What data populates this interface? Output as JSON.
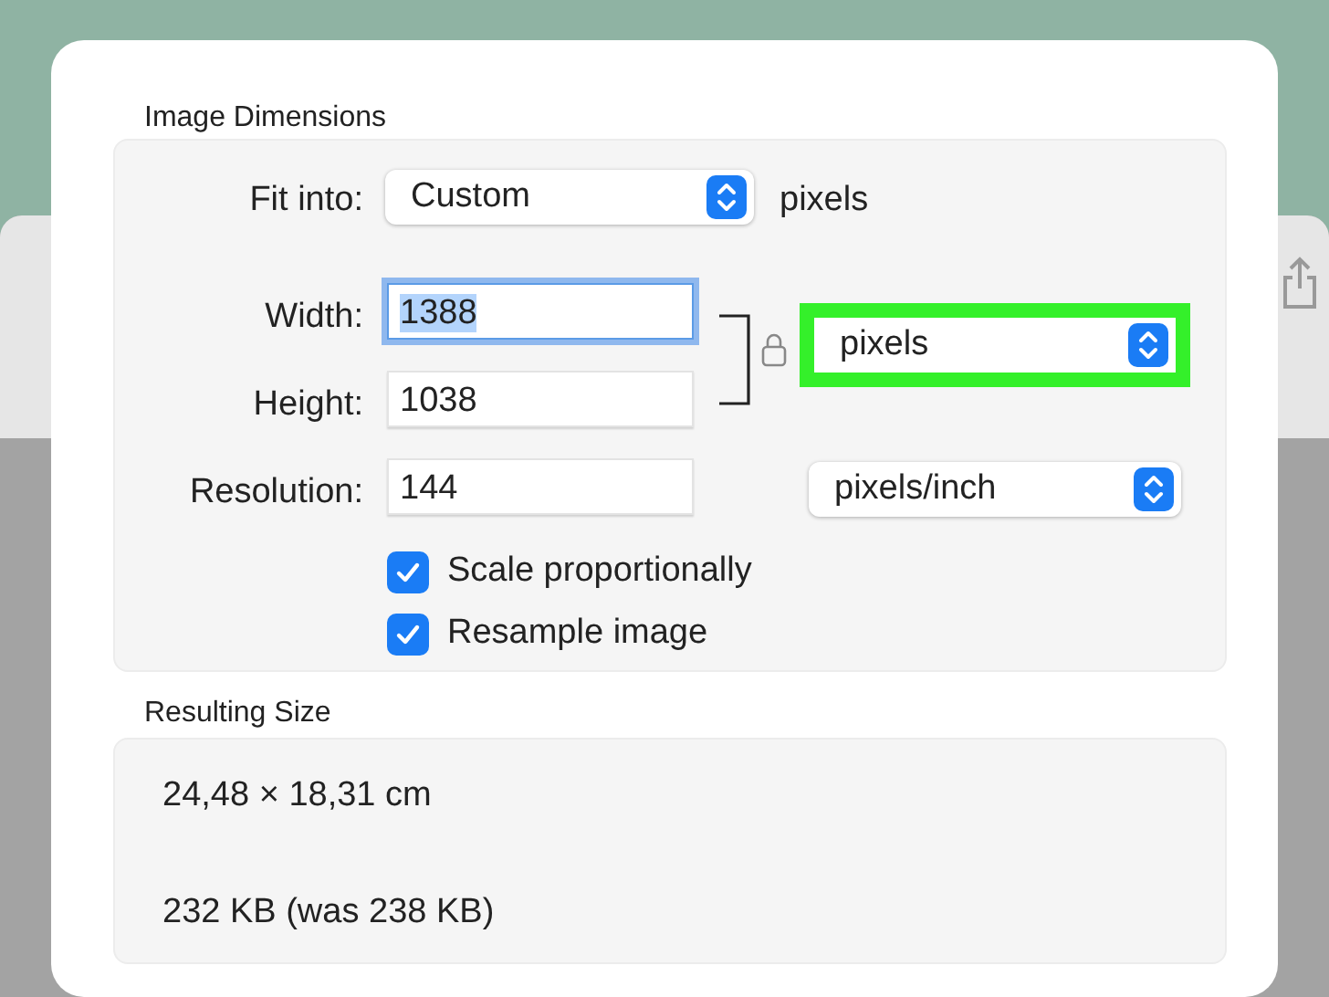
{
  "image_dimensions": {
    "title": "Image Dimensions",
    "fit_into": {
      "label": "Fit into:",
      "value": "Custom",
      "unit": "pixels"
    },
    "fields": [
      {
        "label": "Width:",
        "value": "1388",
        "focused": true
      },
      {
        "label": "Height:",
        "value": "1038",
        "focused": false
      },
      {
        "label": "Resolution:",
        "value": "144",
        "focused": false
      }
    ],
    "size_unit": {
      "value": "pixels",
      "highlighted": true
    },
    "resolution_unit": {
      "value": "pixels/inch",
      "highlighted": false
    },
    "checkboxes": [
      {
        "label": "Scale proportionally",
        "checked": true
      },
      {
        "label": "Resample image",
        "checked": true
      }
    ]
  },
  "resulting_size": {
    "title": "Resulting Size",
    "dimensions": "24,48 × 18,31 cm",
    "file_size": "232 KB (was 238 KB)"
  }
}
